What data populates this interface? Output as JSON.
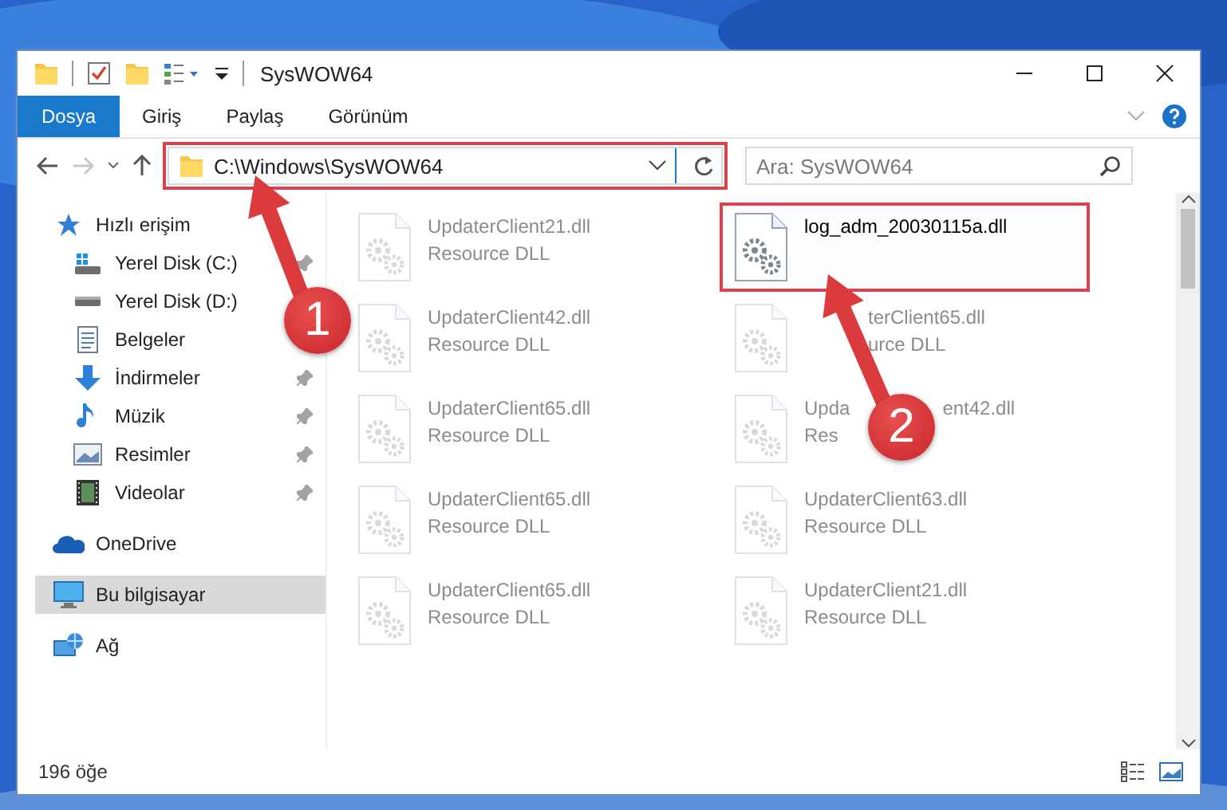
{
  "window": {
    "title": "SysWOW64"
  },
  "ribbon": {
    "tabs": [
      {
        "label": "Dosya",
        "kind": "file",
        "selected": false
      },
      {
        "label": "Giriş",
        "kind": "tab",
        "selected": false
      },
      {
        "label": "Paylaş",
        "kind": "tab",
        "selected": false
      },
      {
        "label": "Görünüm",
        "kind": "tab",
        "selected": false
      }
    ]
  },
  "address": {
    "path": "C:\\Windows\\SysWOW64",
    "highlighted": true
  },
  "search": {
    "placeholder": "Ara: SysWOW64"
  },
  "sidebar": {
    "items": [
      {
        "label": "Hızlı erişim",
        "kind": "star",
        "selected": false,
        "children": [
          {
            "label": "Yerel Disk (C:)",
            "kind": "drive-win",
            "pinned": true,
            "selected": false
          },
          {
            "label": "Yerel Disk (D:)",
            "kind": "drive",
            "pinned": false,
            "selected": false
          },
          {
            "label": "Belgeler",
            "kind": "docs",
            "pinned": false,
            "selected": false
          },
          {
            "label": "İndirmeler",
            "kind": "download",
            "pinned": true,
            "selected": false
          },
          {
            "label": "Müzik",
            "kind": "music",
            "pinned": true,
            "selected": false
          },
          {
            "label": "Resimler",
            "kind": "pictures",
            "pinned": true,
            "selected": false
          },
          {
            "label": "Videolar",
            "kind": "videos",
            "pinned": true,
            "selected": false
          }
        ]
      },
      {
        "label": "OneDrive",
        "kind": "cloud",
        "selected": false
      },
      {
        "label": "Bu bilgisayar",
        "kind": "pc",
        "selected": true
      },
      {
        "label": "Ağ",
        "kind": "network",
        "selected": false
      }
    ]
  },
  "files": [
    {
      "name": "UpdaterClient21.dll",
      "type": "Resource DLL",
      "faded": true,
      "highlighted": false
    },
    {
      "name": "log_adm_20030115a.dll",
      "faded": false,
      "highlighted": true
    },
    {
      "name": "UpdaterClient42.dll",
      "type": "Resource DLL",
      "faded": true,
      "highlighted": false
    },
    {
      "name": [
        "terClient65.dll"
      ],
      "type": [
        "urce DLL"
      ],
      "lead_hidden": true,
      "faded": true,
      "highlighted": false
    },
    {
      "name": "UpdaterClient65.dll",
      "type": "Resource DLL",
      "faded": true,
      "highlighted": false
    },
    {
      "name": [
        "Upda",
        "ent42.dll"
      ],
      "type": [
        "Res"
      ],
      "lead_hidden": false,
      "faded": true,
      "highlighted": false
    },
    {
      "name": "UpdaterClient65.dll",
      "type": "Resource DLL",
      "faded": true,
      "highlighted": false
    },
    {
      "name": "UpdaterClient63.dll",
      "type": "Resource DLL",
      "faded": true,
      "highlighted": false
    },
    {
      "name": "UpdaterClient65.dll",
      "type": "Resource DLL",
      "faded": true,
      "highlighted": false
    },
    {
      "name": "UpdaterClient21.dll",
      "type": "Resource DLL",
      "faded": true,
      "highlighted": false
    }
  ],
  "callouts": [
    {
      "number": "1"
    },
    {
      "number": "2"
    }
  ],
  "status_bar": {
    "count": "196 öğe"
  }
}
